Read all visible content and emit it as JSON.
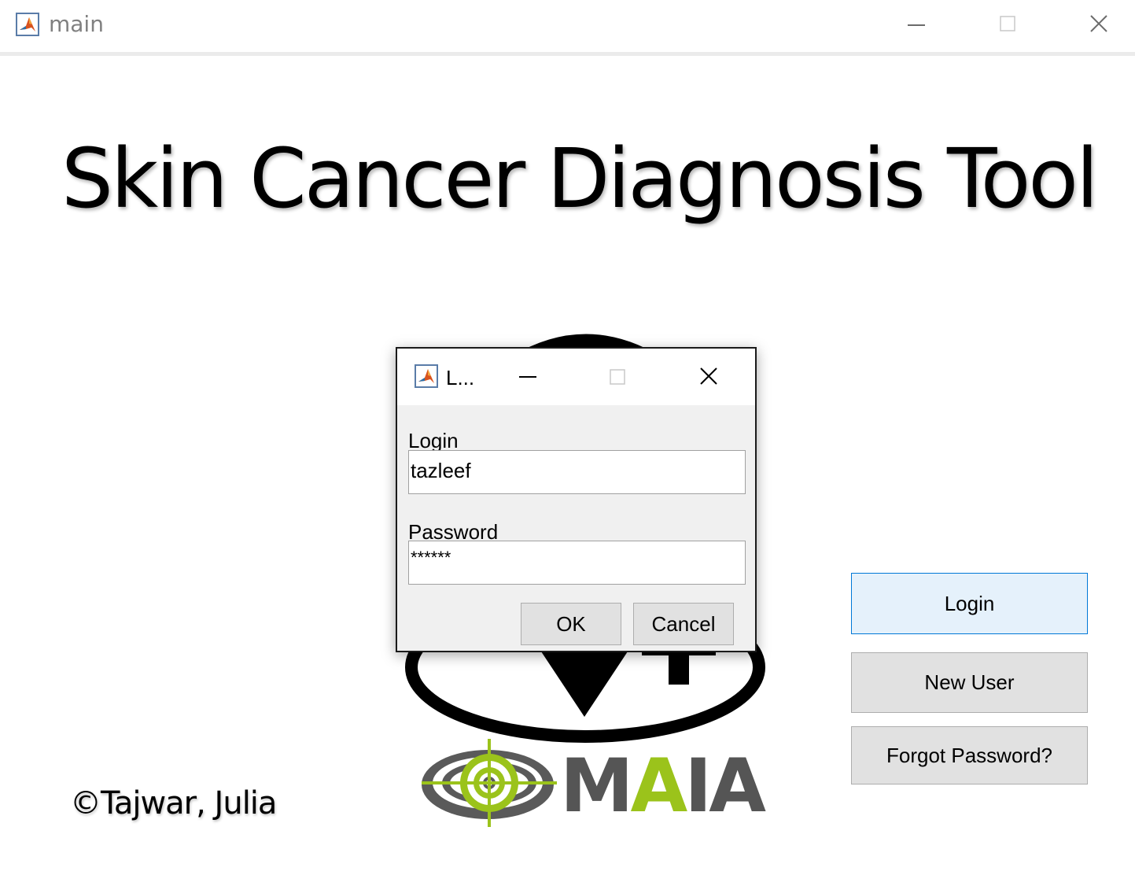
{
  "window": {
    "title": "main",
    "app_icon": "matlab-icon",
    "controls": [
      "minimize-icon",
      "maximize-icon",
      "close-icon"
    ]
  },
  "heading": "Skin Cancer Diagnosis Tool",
  "copyright": "©Tajwar, Julia",
  "logo": {
    "text": "MAIA",
    "accent_color": "#9bc31b",
    "gray_color": "#555555"
  },
  "buttons": {
    "login": "Login",
    "new_user": "New User",
    "forgot_password": "Forgot Password?"
  },
  "dialog": {
    "title": "L...",
    "login_label": "Login",
    "login_value": "tazleef",
    "password_label": "Password",
    "password_value": "******",
    "ok_label": "OK",
    "cancel_label": "Cancel"
  },
  "colors": {
    "primary_button_bg": "#e5f1fb",
    "primary_button_border": "#0078d7",
    "button_bg": "#e1e1e1",
    "dialog_bg": "#f0f0f0"
  }
}
